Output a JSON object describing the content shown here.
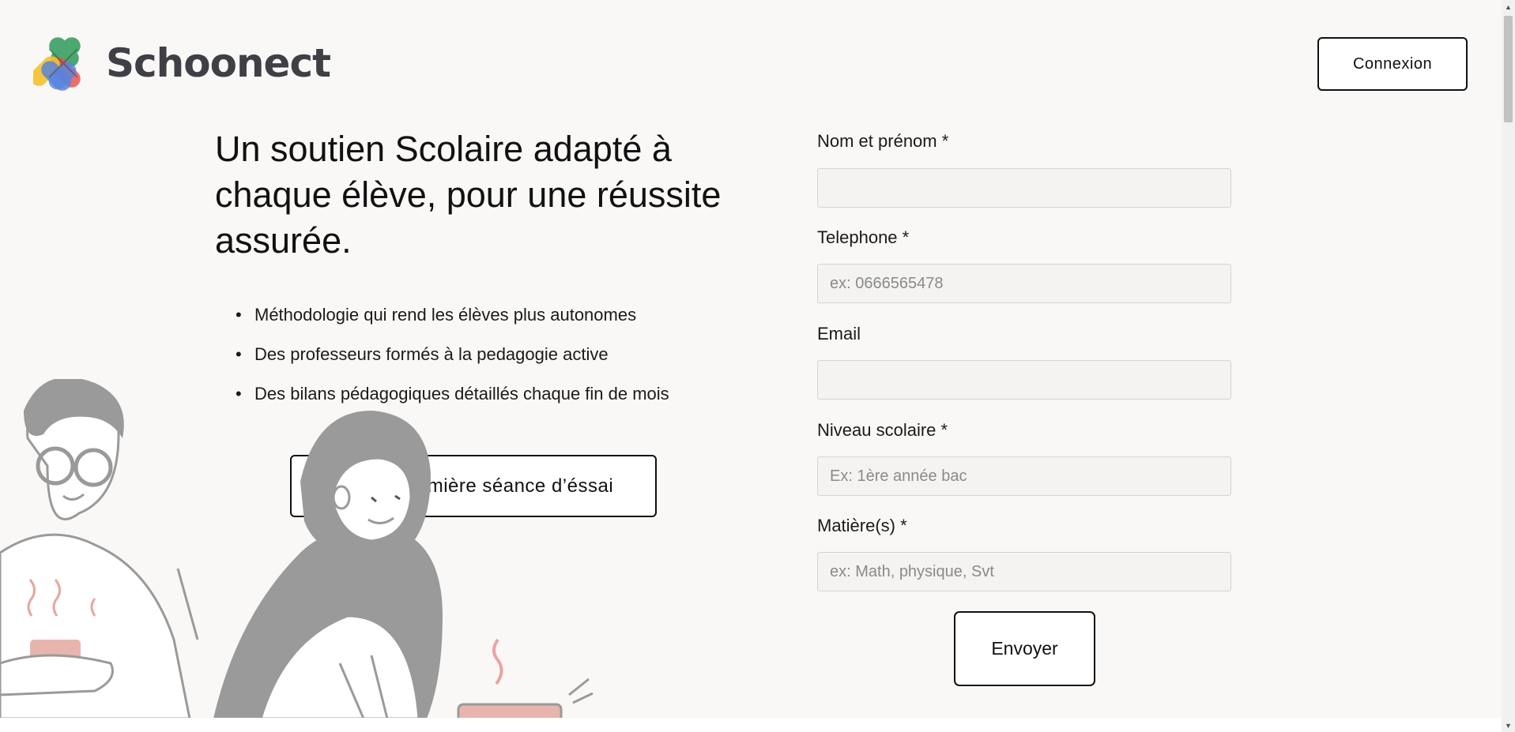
{
  "header": {
    "logo_text": "Schoonect",
    "logo_colors": [
      "#2e9b5a",
      "#e23b3b",
      "#f5b70a",
      "#3d6fd8"
    ],
    "login_label": "Connexion"
  },
  "hero": {
    "title": "Un soutien Scolaire adapté à chaque élève, pour une réussite assurée.",
    "features": [
      "Méthodologie qui rend les élèves plus autonomes",
      "Des professeurs formés à la pedagogie active",
      "Des bilans pédagogiques détaillés chaque fin de mois"
    ],
    "bullet": "•",
    "cta_label": "Fais ta première séance d’éssai"
  },
  "form": {
    "fields": [
      {
        "label": "Nom et prénom *",
        "placeholder": "",
        "value": ""
      },
      {
        "label": "Telephone *",
        "placeholder": "ex: 0666565478",
        "value": ""
      },
      {
        "label": "Email",
        "placeholder": "",
        "value": ""
      },
      {
        "label": "Niveau scolaire *",
        "placeholder": "Ex: 1ère année bac",
        "value": ""
      },
      {
        "label": "Matière(s) *",
        "placeholder": "ex: Math, physique, Svt",
        "value": ""
      }
    ],
    "submit_label": "Envoyer"
  },
  "illustration": {
    "icon": "students-illustration",
    "accent_color": "#e8b4ae",
    "figure_color": "#9a9a9a"
  },
  "scrollbar": {
    "up_arrow": "▲",
    "down_arrow": "▼"
  }
}
